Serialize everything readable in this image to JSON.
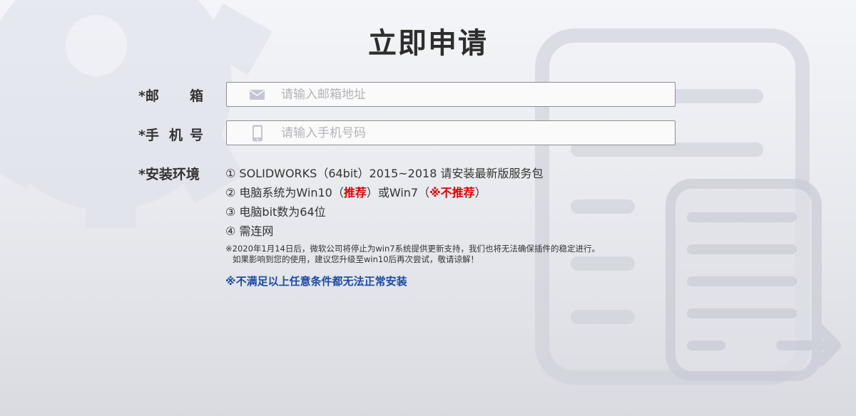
{
  "page": {
    "title": "立即申请"
  },
  "form": {
    "email": {
      "label_prefix": "*邮",
      "label_suffix": "箱",
      "placeholder": "请输入邮箱地址",
      "value": ""
    },
    "phone": {
      "label_prefix": "*手",
      "label_mid": "机",
      "label_suffix": "号",
      "placeholder": "请输入手机号码",
      "value": ""
    }
  },
  "environment": {
    "label": "*安装环境",
    "req1": "① SOLIDWORKS（64bit）2015~2018 请安装最新版服务包",
    "req2_pre": "② 电脑系统为Win10（",
    "req2_rec": "推荐",
    "req2_mid": "）或Win7（",
    "req2_notrec": "※不推荐",
    "req2_post": "）",
    "req3": "③ 电脑bit数为64位",
    "req4": "④ 需连网",
    "notice_line1": "※2020年1月14日后，微软公司将停止为win7系统提供更新支持，我们也将无法确保插件的稳定进行。",
    "notice_line2": "如果影响到您的使用，建议您升级至win10后再次尝试，敬请谅解！",
    "warning": "※不满足以上任意条件都无法正常安装"
  },
  "icons": {
    "email": "envelope-icon",
    "phone": "smartphone-icon"
  },
  "colors": {
    "accent_red": "#e00000",
    "warning_blue": "#1b4aa4",
    "icon": "#c4c6d3"
  }
}
